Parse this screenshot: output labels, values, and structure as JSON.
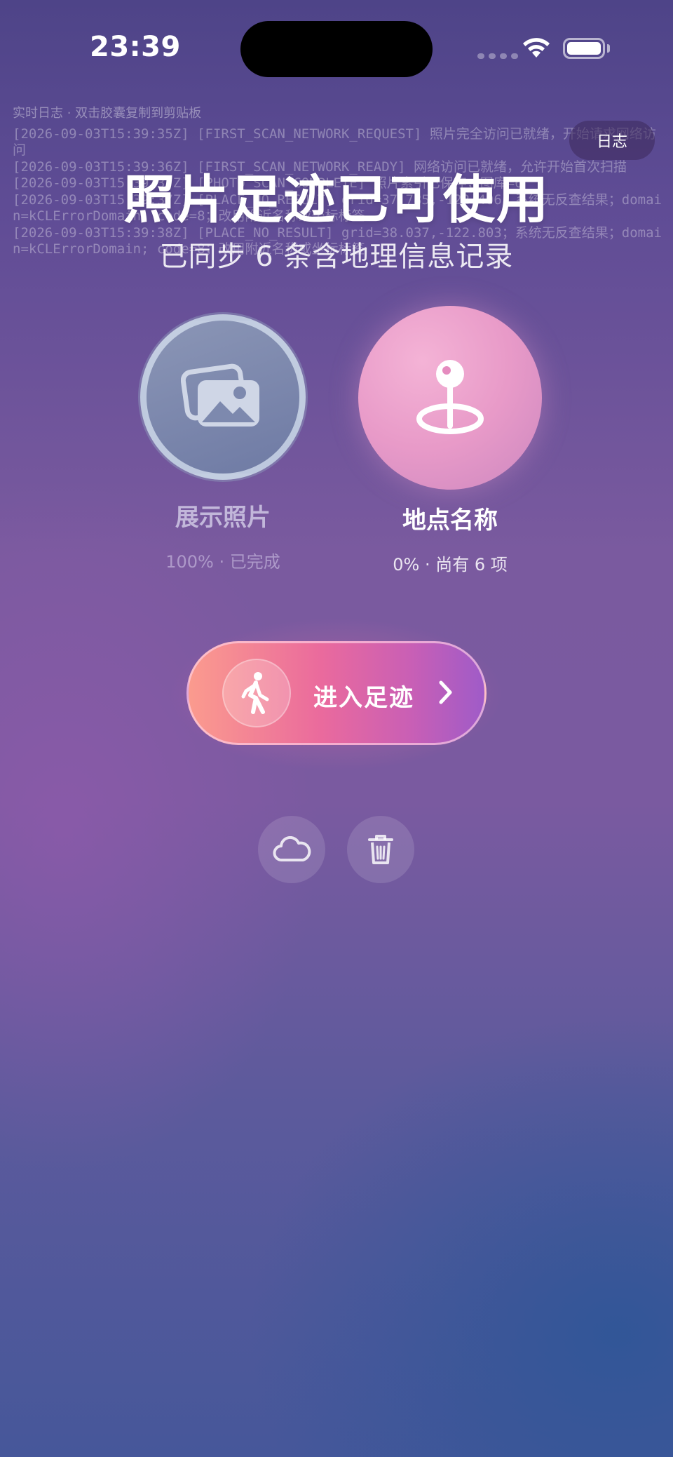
{
  "status_bar": {
    "time": "23:39"
  },
  "log": {
    "hint": "实时日志 · 双击胶囊复制到剪贴板",
    "lines": [
      "[2026-09-03T15:39:35Z] [FIRST_SCAN_NETWORK_REQUEST] 照片完全访问已就绪，开始请求网络访问",
      "[2026-09-03T15:39:36Z] [FIRST_SCAN_NETWORK_READY] 网络访问已就绪，允许开始首次扫描",
      "[2026-09-03T15:39:37Z] [PHOTO_SCAN_COMPLETE] 照片索引已保存；图库=6",
      "[2026-09-03T15:39:37Z] [PLACE_NO_RESULT] grid=37.785,-122.406；系统无反查结果；domain=kCLErrorDomain; code=8；改用附近名称或坐标标签",
      "[2026-09-03T15:39:38Z] [PLACE_NO_RESULT] grid=38.037,-122.803；系统无反查结果；domain=kCLErrorDomain; code=8；改用附近名称或坐标标签"
    ],
    "button_label": "日志"
  },
  "header": {
    "title": "照片足迹已可使用",
    "subtitle": "已同步 6 条含地理信息记录"
  },
  "steps": {
    "photos": {
      "label": "展示照片",
      "status": "100% · 已完成",
      "progress": 1.0,
      "icon": "photos-stack-icon"
    },
    "places": {
      "label": "地点名称",
      "status": "0% · 尚有 6 项",
      "progress": 0.0,
      "icon": "location-pin-icon"
    }
  },
  "cta": {
    "label": "进入足迹",
    "icon": "walking-person-icon"
  },
  "actions": {
    "cloud_icon": "cloud-icon",
    "trash_icon": "trash-icon"
  },
  "colors": {
    "cta_gradient_start": "#fb9b8e",
    "cta_gradient_end": "#9f5bc8",
    "places_circle": "#e89ac8",
    "photos_circle": "#7c88ad"
  }
}
